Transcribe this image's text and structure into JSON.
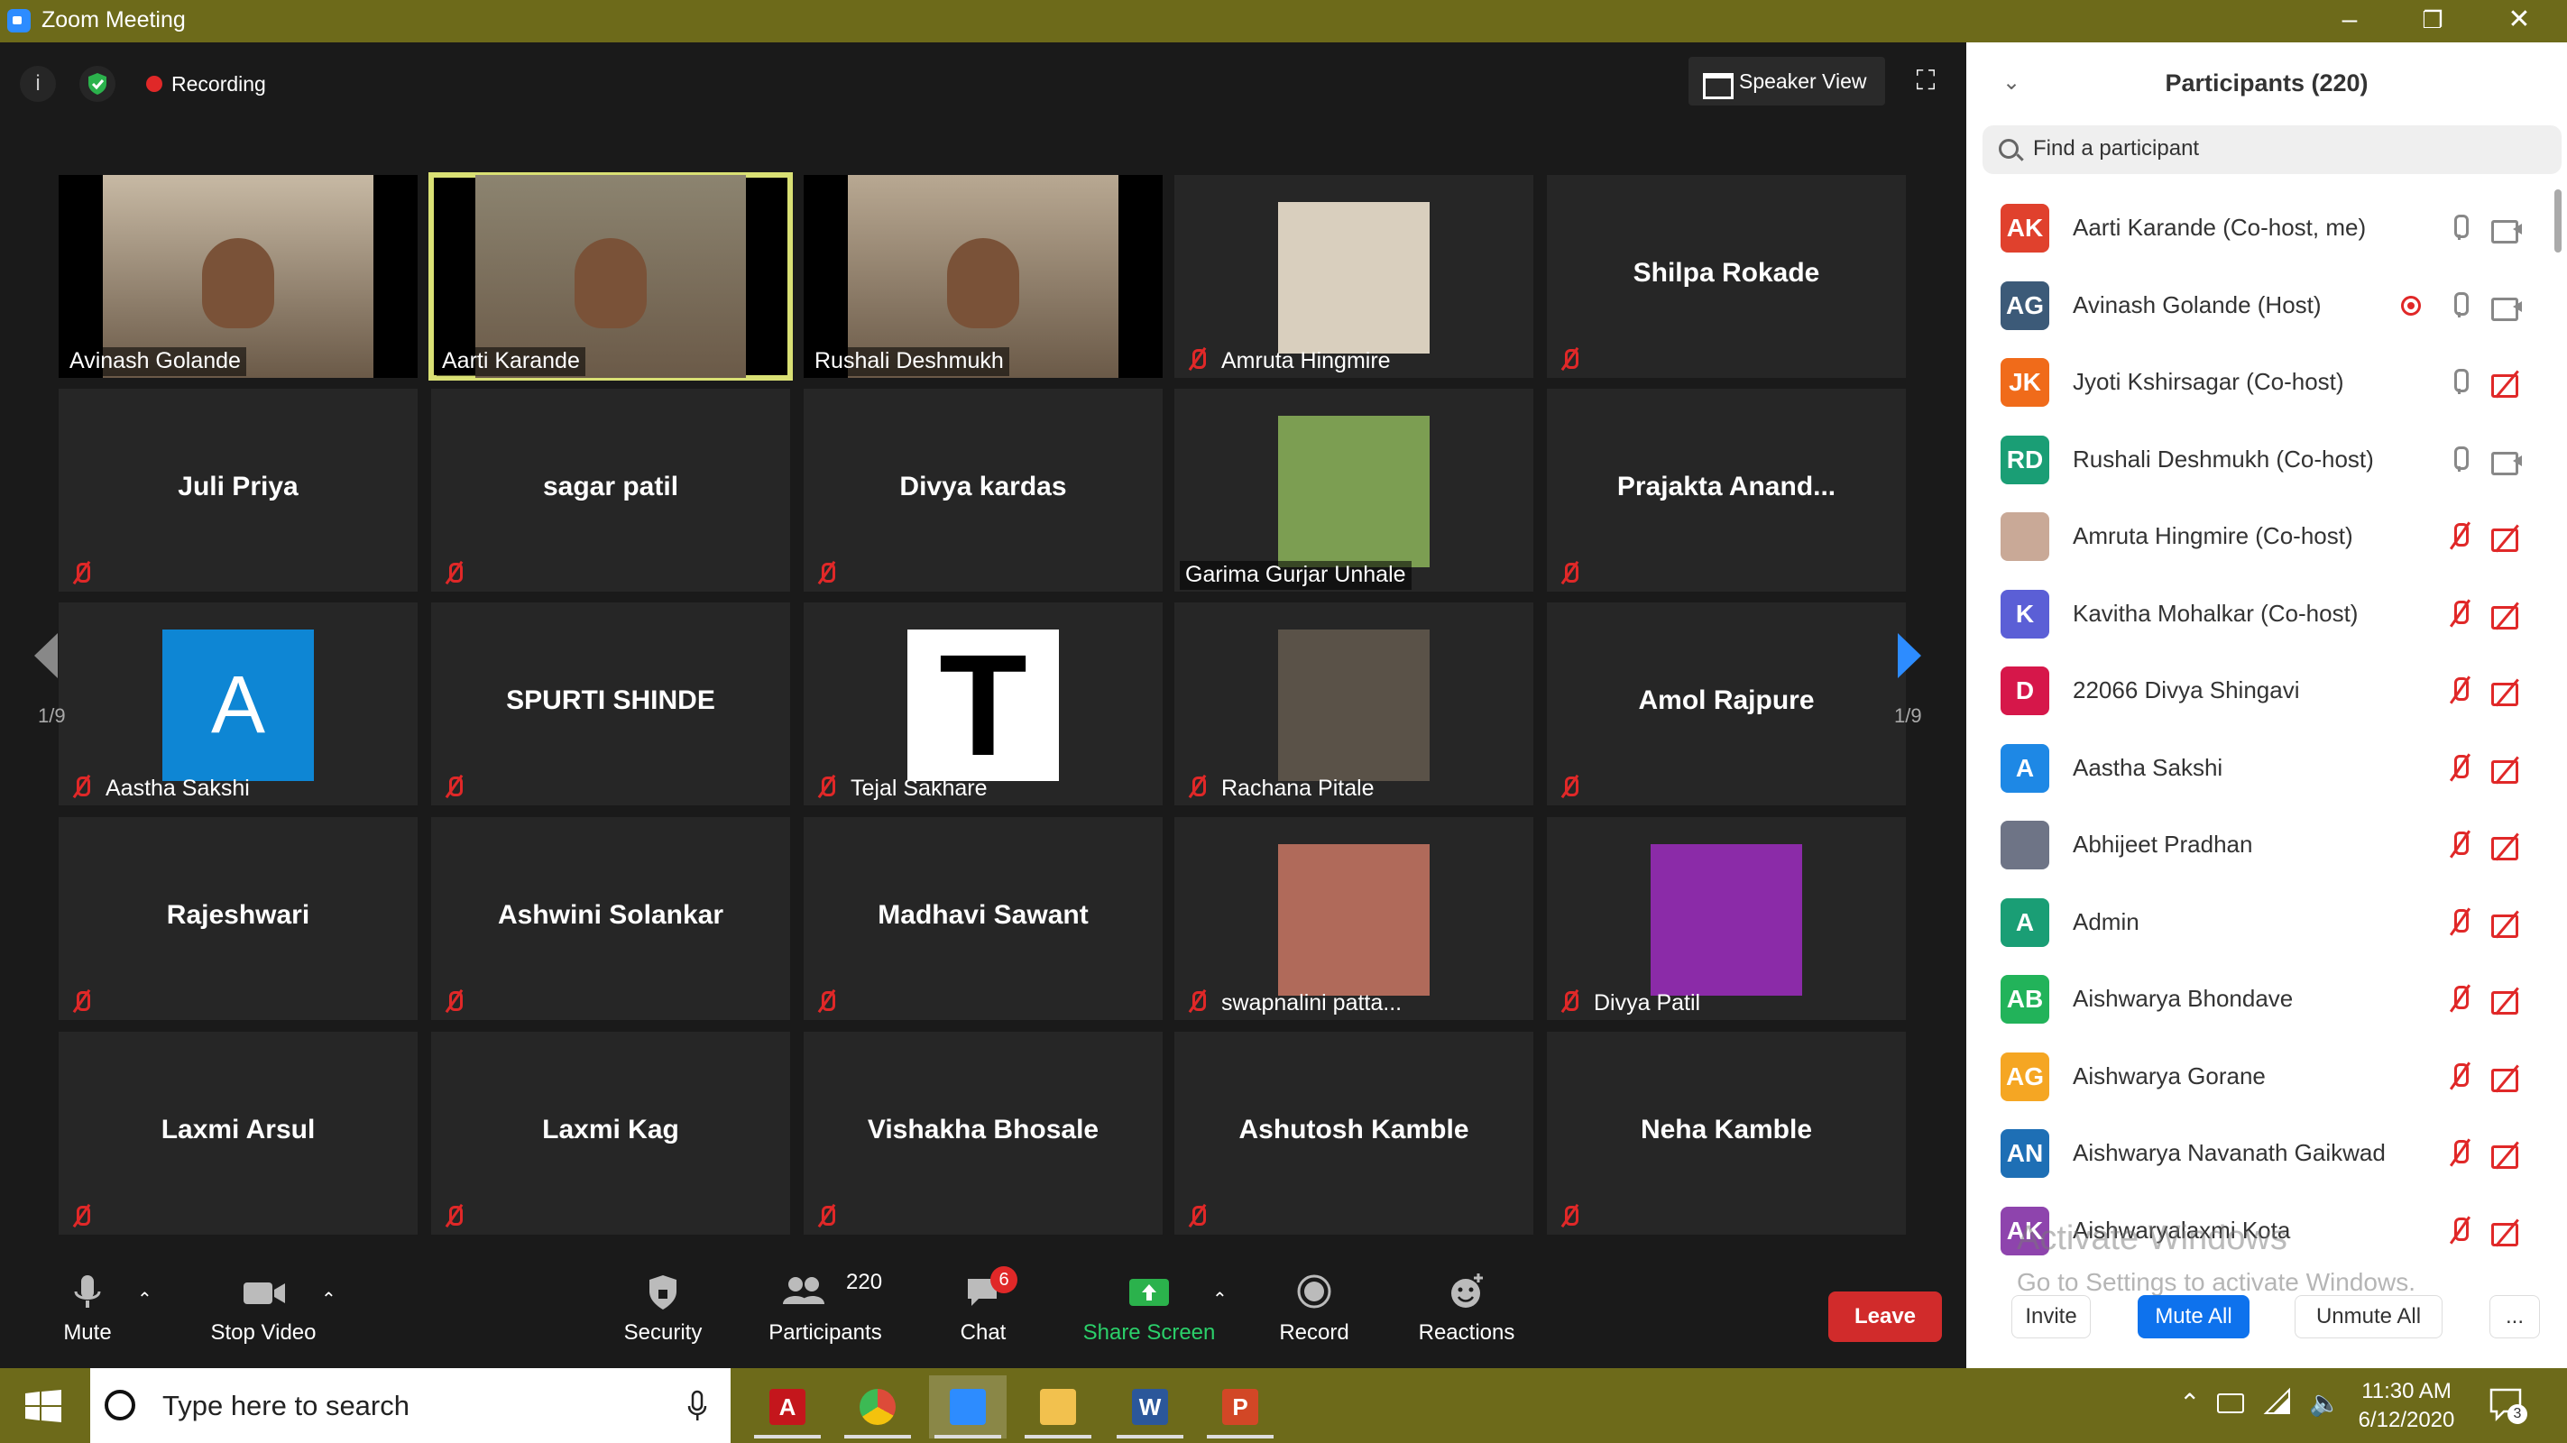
{
  "window": {
    "title": "Zoom Meeting",
    "minimize": "–",
    "restore": "❐",
    "close": "✕"
  },
  "meeting": {
    "recording_label": "Recording",
    "speaker_view_label": "Speaker View",
    "page_left": "1/9",
    "page_right": "1/9"
  },
  "tiles": [
    {
      "name": "Avinash Golande",
      "video": true,
      "muted": false,
      "bg": "#c7b9a4"
    },
    {
      "name": "Aarti Karande",
      "video": true,
      "muted": false,
      "active": true,
      "bg": "#8c8470"
    },
    {
      "name": "Rushali Deshmukh",
      "video": true,
      "muted": false,
      "bg": "#b8a892"
    },
    {
      "name": "Amruta Hingmire",
      "thumb": true,
      "muted": true,
      "bg": "#d9cfbe"
    },
    {
      "name": "Shilpa Rokade",
      "muted": true
    },
    {
      "name": "Juli Priya",
      "muted": true
    },
    {
      "name": "sagar patil",
      "muted": true
    },
    {
      "name": "Divya kardas",
      "muted": true
    },
    {
      "name": "Garima Gurjar Unhale",
      "thumb": true,
      "muted": false,
      "bg": "#7c9e52"
    },
    {
      "name": "Prajakta  Anand...",
      "muted": true
    },
    {
      "name": "Aastha Sakshi",
      "thumb": true,
      "letter": "A",
      "muted": true,
      "bg": "#0e86d4"
    },
    {
      "name": "SPURTI  SHINDE",
      "muted": true
    },
    {
      "name": "Tejal Sakhare",
      "thumb": true,
      "letter": "T",
      "muted": true,
      "bg": "#ffffff"
    },
    {
      "name": "Rachana Pitale",
      "thumb": true,
      "muted": true,
      "bg": "#5a5248"
    },
    {
      "name": "Amol Rajpure",
      "muted": true
    },
    {
      "name": "Rajeshwari",
      "muted": true
    },
    {
      "name": "Ashwini Solankar",
      "muted": true
    },
    {
      "name": "Madhavi Sawant",
      "muted": true
    },
    {
      "name": "swapnalini patta...",
      "thumb": true,
      "muted": true,
      "bg": "#b06a5a"
    },
    {
      "name": "Divya Patil",
      "thumb": true,
      "muted": true,
      "bg": "#8b2ba8"
    },
    {
      "name": "Laxmi Arsul",
      "muted": true
    },
    {
      "name": "Laxmi Kag",
      "muted": true
    },
    {
      "name": "Vishakha Bhosale",
      "muted": true
    },
    {
      "name": "Ashutosh Kamble",
      "muted": true
    },
    {
      "name": "Neha Kamble",
      "muted": true
    }
  ],
  "toolbar": {
    "mute": "Mute",
    "stop_video": "Stop Video",
    "security": "Security",
    "participants": "Participants",
    "participants_count": "220",
    "chat": "Chat",
    "chat_badge": "6",
    "share_screen": "Share Screen",
    "record": "Record",
    "reactions": "Reactions",
    "leave": "Leave"
  },
  "panel": {
    "title": "Participants (220)",
    "search_placeholder": "Find a participant",
    "participants": [
      {
        "initials": "AK",
        "name": "Aarti Karande (Co-host, me)",
        "color": "#e0412d",
        "mic": "on",
        "cam": "on"
      },
      {
        "initials": "AG",
        "name": "Avinash Golande (Host)",
        "color": "#3c5a78",
        "mic": "on",
        "cam": "on",
        "rec": true
      },
      {
        "initials": "JK",
        "name": "Jyoti Kshirsagar (Co-host)",
        "color": "#f06b1a",
        "mic": "on",
        "cam": "off"
      },
      {
        "initials": "RD",
        "name": "Rushali Deshmukh (Co-host)",
        "color": "#1a9e75",
        "mic": "on",
        "cam": "on"
      },
      {
        "initials": "",
        "name": "Amruta Hingmire (Co-host)",
        "color": "#c9a997",
        "mic": "off",
        "cam": "off"
      },
      {
        "initials": "K",
        "name": "Kavitha Mohalkar (Co-host)",
        "color": "#5b5fd6",
        "mic": "off",
        "cam": "off"
      },
      {
        "initials": "D",
        "name": "22066 Divya Shingavi",
        "color": "#d6174a",
        "mic": "off",
        "cam": "off"
      },
      {
        "initials": "A",
        "name": "Aastha Sakshi",
        "color": "#1e88e5",
        "mic": "off",
        "cam": "off"
      },
      {
        "initials": "",
        "name": "Abhijeet Pradhan",
        "color": "#6e7486",
        "mic": "off",
        "cam": "off"
      },
      {
        "initials": "A",
        "name": "Admin",
        "color": "#1a9e75",
        "mic": "off",
        "cam": "off"
      },
      {
        "initials": "AB",
        "name": "Aishwarya Bhondave",
        "color": "#22b35a",
        "mic": "off",
        "cam": "off"
      },
      {
        "initials": "AG",
        "name": "Aishwarya Gorane",
        "color": "#f5a623",
        "mic": "off",
        "cam": "off"
      },
      {
        "initials": "AN",
        "name": "Aishwarya Navanath Gaikwad",
        "color": "#1e6fb5",
        "mic": "off",
        "cam": "off"
      },
      {
        "initials": "AK",
        "name": "Aishwaryalaxmi Kota",
        "color": "#8e44ad",
        "mic": "off",
        "cam": "off"
      }
    ],
    "invite": "Invite",
    "mute_all": "Mute All",
    "unmute_all": "Unmute All",
    "more": "..."
  },
  "watermark": {
    "line1": "Activate Windows",
    "line2": "Go to Settings to activate Windows."
  },
  "taskbar": {
    "search_placeholder": "Type here to search",
    "apps": [
      {
        "name": "acrobat",
        "color": "#c4161c",
        "glyph": "A"
      },
      {
        "name": "chrome",
        "color": "#dd4b39",
        "glyph": ""
      },
      {
        "name": "zoom",
        "color": "#2d8cff",
        "glyph": ""
      },
      {
        "name": "explorer",
        "color": "#f2c14e",
        "glyph": ""
      },
      {
        "name": "word",
        "color": "#2b579a",
        "glyph": "W"
      },
      {
        "name": "powerpoint",
        "color": "#d24726",
        "glyph": "P"
      }
    ],
    "time": "11:30 AM",
    "date": "6/12/2020",
    "notification_count": "3"
  }
}
